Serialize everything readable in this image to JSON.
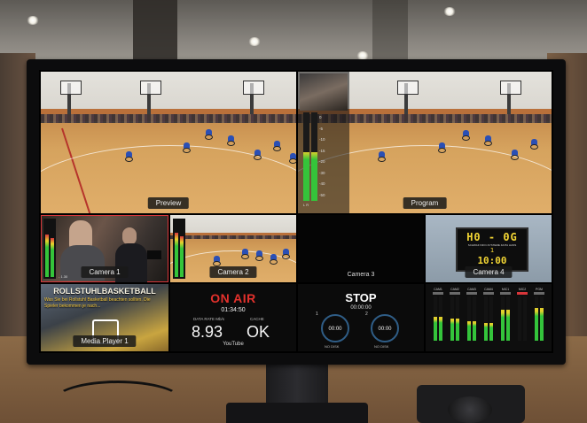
{
  "scene": "Live production monitor in a sports hall showing a vMix-style multiview",
  "preview": {
    "label": "Preview"
  },
  "program": {
    "label": "Program",
    "meter_scale": [
      "0",
      "-5",
      "-10",
      "-15",
      "-20",
      "-30",
      "-40",
      "-50"
    ],
    "meter_channels": "L R"
  },
  "cameras": {
    "camera1": {
      "label": "Camera 1"
    },
    "camera2": {
      "label": "Camera 2"
    },
    "camera3": {
      "label": "Camera 3"
    },
    "camera4": {
      "label": "Camera 4",
      "scoreboard": {
        "score": "H0 - 0G",
        "line": "SCHWAF INFO-SYSTEME 42151 HANS",
        "period": "1",
        "clock": "10:00"
      }
    },
    "camera1_small": "- 1.30"
  },
  "media_player": {
    "label": "Media Player 1",
    "title": "ROLLSTUHLBASKETBALL",
    "text": "Was Sie bei Rollstuhl Basketball beachten sollten. Die Spieler bekommen je nach..."
  },
  "on_air": {
    "title": "ON AIR",
    "time": "01:34:50",
    "datarate_label": "DATA RATE Mb/s",
    "datarate_value": "8.93",
    "cache_label": "CACHE",
    "cache_value": "OK",
    "destination": "YouTube"
  },
  "stop": {
    "title": "STOP",
    "time": "00:00:00",
    "recorder1": {
      "num": "1",
      "time": "00:00",
      "sub": "00:00:00",
      "label": "NO DISK"
    },
    "recorder2": {
      "num": "2",
      "time": "00:00",
      "sub": "00:00:00",
      "label": "NO DISK"
    }
  },
  "audio_mixer": {
    "channels": [
      "CAM1",
      "CAM2",
      "CAM3",
      "CAM4",
      "MIC1",
      "MIC2",
      "PGM"
    ],
    "levels": [
      0.55,
      0.5,
      0.45,
      0.4,
      0.7,
      0.0,
      0.75
    ],
    "muted": [
      false,
      false,
      false,
      false,
      false,
      true,
      false
    ]
  },
  "colors": {
    "on_air_red": "#e4312c",
    "tally_red": "#d8363a",
    "meter_green": "#35c43a",
    "scoreboard_yellow": "#f2d534"
  }
}
